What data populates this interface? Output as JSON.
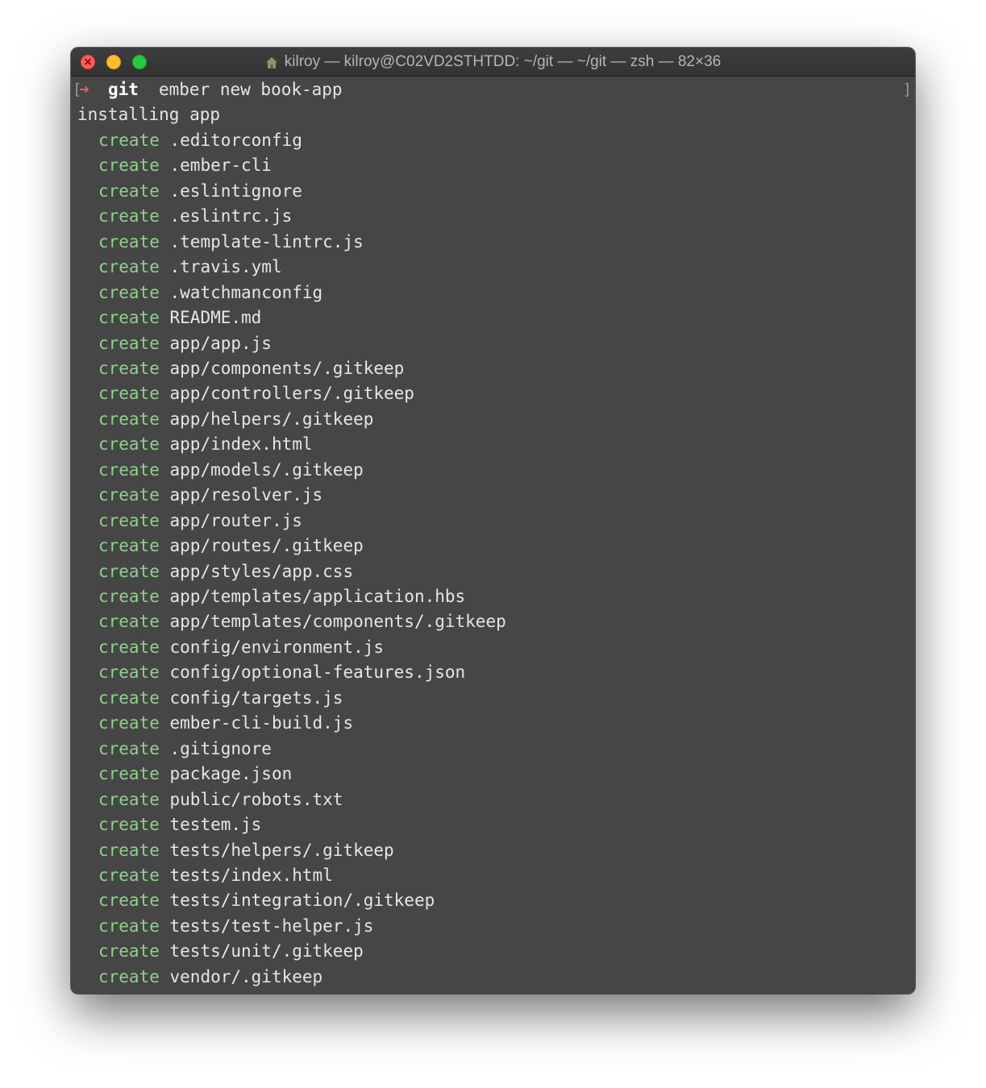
{
  "window": {
    "title": "kilroy — kilroy@C02VD2STHTDD: ~/git — ~/git — zsh — 82×36",
    "title_icon": "home-folder-icon"
  },
  "prompt": {
    "arrow": "➜",
    "directory": "git",
    "command": "ember new book-app",
    "left_marker": "[",
    "right_marker": "]"
  },
  "output": {
    "header": "installing app",
    "create_keyword": "create",
    "files": [
      ".editorconfig",
      ".ember-cli",
      ".eslintignore",
      ".eslintrc.js",
      ".template-lintrc.js",
      ".travis.yml",
      ".watchmanconfig",
      "README.md",
      "app/app.js",
      "app/components/.gitkeep",
      "app/controllers/.gitkeep",
      "app/helpers/.gitkeep",
      "app/index.html",
      "app/models/.gitkeep",
      "app/resolver.js",
      "app/router.js",
      "app/routes/.gitkeep",
      "app/styles/app.css",
      "app/templates/application.hbs",
      "app/templates/components/.gitkeep",
      "config/environment.js",
      "config/optional-features.json",
      "config/targets.js",
      "ember-cli-build.js",
      ".gitignore",
      "package.json",
      "public/robots.txt",
      "testem.js",
      "tests/helpers/.gitkeep",
      "tests/index.html",
      "tests/integration/.gitkeep",
      "tests/test-helper.js",
      "tests/unit/.gitkeep",
      "vendor/.gitkeep"
    ]
  },
  "colors": {
    "terminal_bg": "#464646",
    "text": "#e6e6e6",
    "create_green": "#8fd18b",
    "prompt_arrow": "#f25d5d"
  }
}
